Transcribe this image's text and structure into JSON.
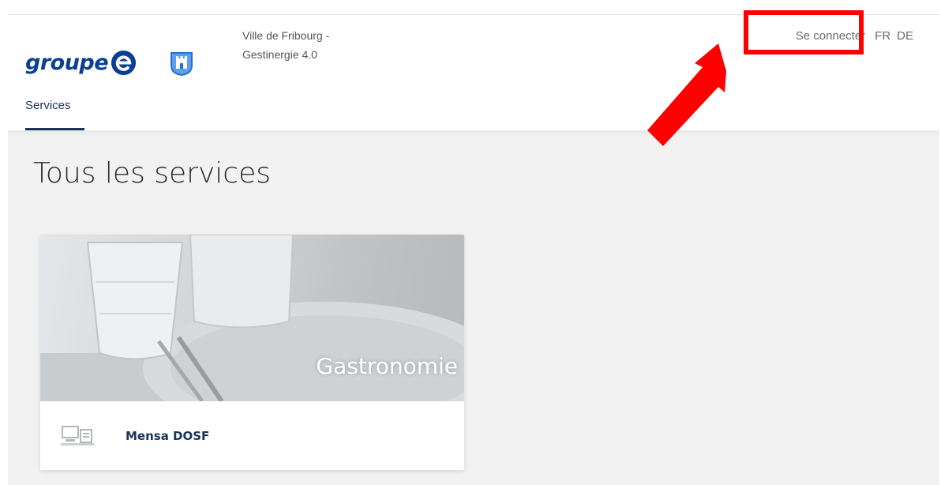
{
  "brand": {
    "logo_text": "groupe",
    "logo_color": "#0b3f91"
  },
  "site": {
    "line1": "Ville de Fribourg -",
    "line2": "Gestinergie 4.0"
  },
  "nav": {
    "tabs": [
      {
        "label": "Services",
        "active": true
      }
    ]
  },
  "header_actions": {
    "login_label": "Se connecter",
    "languages": [
      "FR",
      "DE"
    ],
    "active_language": "FR"
  },
  "annotation": {
    "highlight_color": "#ff0000",
    "arrow_color": "#ff0000"
  },
  "main": {
    "title": "Tous les services",
    "cards": [
      {
        "category": "Gastronomie",
        "service_name": "Mensa DOSF",
        "icon": "computer-icon"
      }
    ]
  },
  "colors": {
    "accent": "#1b3557",
    "background": "#f2f2f2"
  }
}
